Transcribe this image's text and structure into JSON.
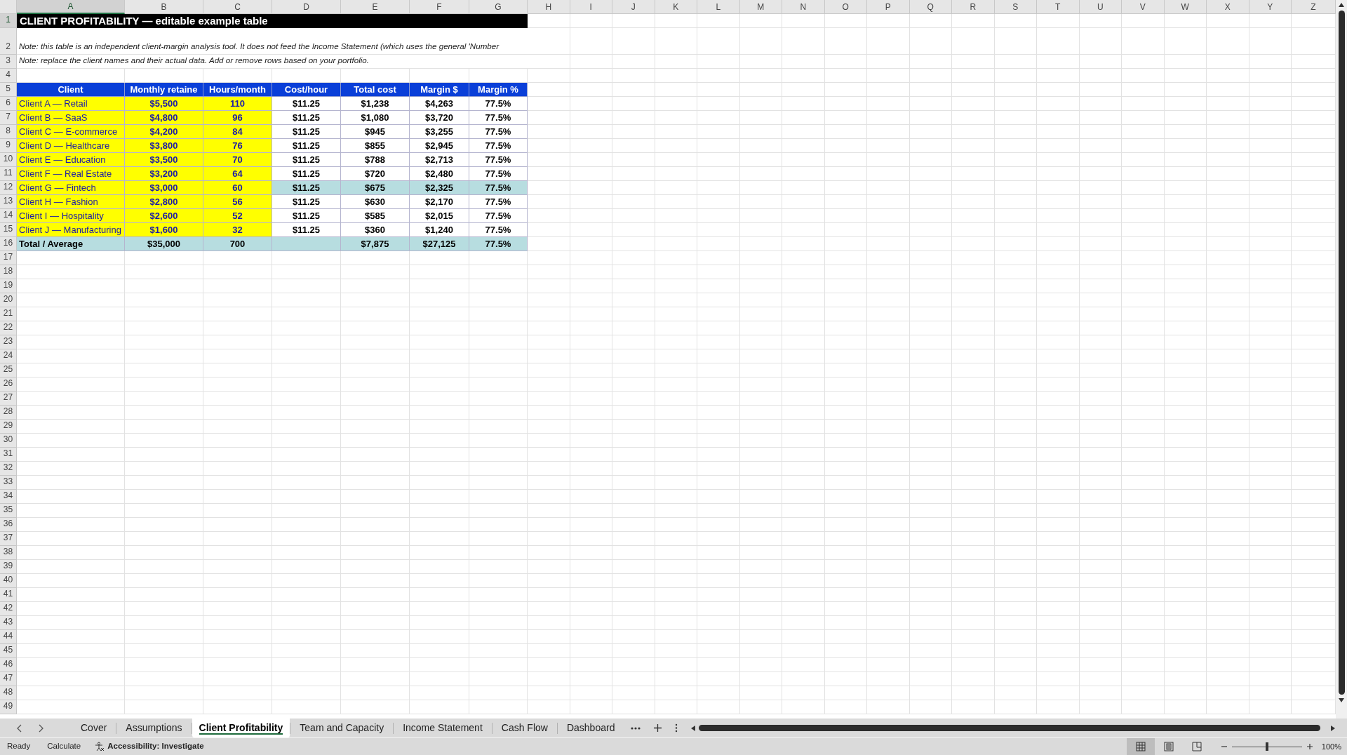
{
  "columns": [
    {
      "label": "A",
      "selected": true
    },
    {
      "label": "B",
      "selected": false
    },
    {
      "label": "C",
      "selected": false
    },
    {
      "label": "D",
      "selected": false
    },
    {
      "label": "E",
      "selected": false
    },
    {
      "label": "F",
      "selected": false
    },
    {
      "label": "G",
      "selected": false
    },
    {
      "label": "H",
      "selected": false
    },
    {
      "label": "I",
      "selected": false
    },
    {
      "label": "J",
      "selected": false
    },
    {
      "label": "K",
      "selected": false
    },
    {
      "label": "L",
      "selected": false
    },
    {
      "label": "M",
      "selected": false
    },
    {
      "label": "N",
      "selected": false
    },
    {
      "label": "O",
      "selected": false
    },
    {
      "label": "P",
      "selected": false
    },
    {
      "label": "Q",
      "selected": false
    },
    {
      "label": "R",
      "selected": false
    },
    {
      "label": "S",
      "selected": false
    },
    {
      "label": "T",
      "selected": false
    },
    {
      "label": "U",
      "selected": false
    },
    {
      "label": "V",
      "selected": false
    },
    {
      "label": "W",
      "selected": false
    },
    {
      "label": "X",
      "selected": false
    },
    {
      "label": "Y",
      "selected": false
    },
    {
      "label": "Z",
      "selected": false
    }
  ],
  "row_numbers": [
    "1",
    "2",
    "3",
    "4",
    "5",
    "6",
    "7",
    "8",
    "9",
    "10",
    "11",
    "12",
    "13",
    "14",
    "15",
    "16",
    "17",
    "18",
    "19",
    "20",
    "21",
    "22",
    "23",
    "24",
    "25",
    "26",
    "27",
    "28",
    "29",
    "30",
    "31",
    "32",
    "33",
    "34",
    "35",
    "36",
    "37",
    "38",
    "39",
    "40",
    "41",
    "42",
    "43",
    "44",
    "45",
    "46",
    "47",
    "48",
    "49"
  ],
  "title": "CLIENT PROFITABILITY — editable example table",
  "notes": [
    "Note: this table is an independent client-margin analysis tool. It does not feed the Income Statement (which uses the general 'Number",
    "Note: replace the client names and their actual data. Add or remove rows based on your portfolio."
  ],
  "table": {
    "columns": [
      "Client",
      "Monthly retaine",
      "Hours/month",
      "Cost/hour",
      "Total cost",
      "Margin $",
      "Margin %"
    ],
    "rows": [
      {
        "kind": "data",
        "highlighted": false,
        "cells": [
          "Client A — Retail",
          "$5,500",
          "110",
          "$11.25",
          "$1,238",
          "$4,263",
          "77.5%"
        ]
      },
      {
        "kind": "data",
        "highlighted": false,
        "cells": [
          "Client B — SaaS",
          "$4,800",
          "96",
          "$11.25",
          "$1,080",
          "$3,720",
          "77.5%"
        ]
      },
      {
        "kind": "data",
        "highlighted": false,
        "cells": [
          "Client C — E-commerce",
          "$4,200",
          "84",
          "$11.25",
          "$945",
          "$3,255",
          "77.5%"
        ]
      },
      {
        "kind": "data",
        "highlighted": false,
        "cells": [
          "Client D — Healthcare",
          "$3,800",
          "76",
          "$11.25",
          "$855",
          "$2,945",
          "77.5%"
        ]
      },
      {
        "kind": "data",
        "highlighted": false,
        "cells": [
          "Client E — Education",
          "$3,500",
          "70",
          "$11.25",
          "$788",
          "$2,713",
          "77.5%"
        ]
      },
      {
        "kind": "data",
        "highlighted": false,
        "cells": [
          "Client F — Real Estate",
          "$3,200",
          "64",
          "$11.25",
          "$720",
          "$2,480",
          "77.5%"
        ]
      },
      {
        "kind": "data",
        "highlighted": true,
        "cells": [
          "Client G — Fintech",
          "$3,000",
          "60",
          "$11.25",
          "$675",
          "$2,325",
          "77.5%"
        ]
      },
      {
        "kind": "data",
        "highlighted": false,
        "cells": [
          "Client H — Fashion",
          "$2,800",
          "56",
          "$11.25",
          "$630",
          "$2,170",
          "77.5%"
        ]
      },
      {
        "kind": "data",
        "highlighted": false,
        "cells": [
          "Client I — Hospitality",
          "$2,600",
          "52",
          "$11.25",
          "$585",
          "$2,015",
          "77.5%"
        ]
      },
      {
        "kind": "data",
        "highlighted": false,
        "cells": [
          "Client J — Manufacturing",
          "$1,600",
          "32",
          "$11.25",
          "$360",
          "$1,240",
          "77.5%"
        ]
      },
      {
        "kind": "total",
        "cells": [
          "Total / Average",
          "$35,000",
          "700",
          null,
          "$7,875",
          "$27,125",
          "77.5%"
        ]
      }
    ]
  },
  "sheet_tabs": [
    {
      "label": "Cover",
      "selected": false
    },
    {
      "label": "Assumptions",
      "selected": false
    },
    {
      "label": "Client Profitability",
      "selected": true
    },
    {
      "label": "Team and Capacity",
      "selected": false
    },
    {
      "label": "Income Statement",
      "selected": false
    },
    {
      "label": "Cash Flow",
      "selected": false
    },
    {
      "label": "Dashboard",
      "selected": false
    }
  ],
  "status_bar": {
    "mode": "Ready",
    "calculate": "Calculate",
    "accessibility": "Accessibility: Investigate",
    "views": [
      {
        "kind": "normal",
        "selected": true
      },
      {
        "kind": "page_layout",
        "selected": false
      },
      {
        "kind": "page_break",
        "selected": false
      }
    ],
    "zoom": {
      "level": 0.5,
      "reading": "100%"
    }
  }
}
